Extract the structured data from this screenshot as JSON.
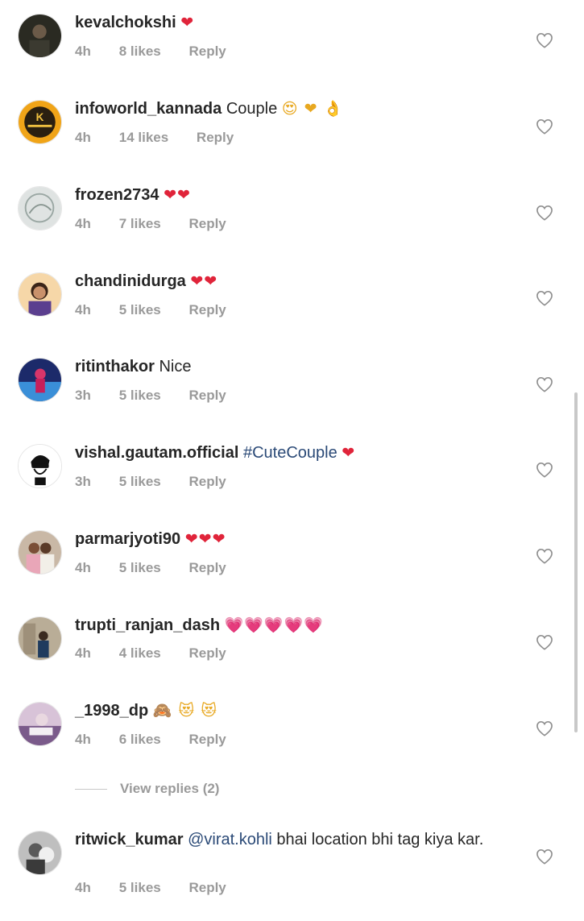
{
  "comments": [
    {
      "username": "kevalchokshi",
      "text": "",
      "emoji": "❤",
      "time": "4h",
      "likes": "8 likes",
      "reply": "Reply"
    },
    {
      "username": "infoworld_kannada",
      "text": "Couple",
      "emoji": "😍 ❤ 👌",
      "time": "4h",
      "likes": "14 likes",
      "reply": "Reply"
    },
    {
      "username": "frozen2734",
      "text": "",
      "emoji": "❤❤",
      "time": "4h",
      "likes": "7 likes",
      "reply": "Reply"
    },
    {
      "username": "chandinidurga",
      "text": "",
      "emoji": "❤❤",
      "time": "4h",
      "likes": "5 likes",
      "reply": "Reply"
    },
    {
      "username": "ritinthakor",
      "text": "Nice",
      "emoji": "",
      "time": "3h",
      "likes": "5 likes",
      "reply": "Reply"
    },
    {
      "username": "vishal.gautam.official",
      "text": "",
      "hashtag": "#CuteCouple",
      "emoji": "❤",
      "time": "3h",
      "likes": "5 likes",
      "reply": "Reply"
    },
    {
      "username": "parmarjyoti90",
      "text": "",
      "emoji": "❤❤❤",
      "time": "4h",
      "likes": "5 likes",
      "reply": "Reply"
    },
    {
      "username": "trupti_ranjan_dash",
      "text": "",
      "emoji": "💗💗💗💗💗",
      "time": "4h",
      "likes": "4 likes",
      "reply": "Reply"
    },
    {
      "username": "_1998_dp",
      "text": "",
      "emoji": "🙈 😻 😻",
      "time": "4h",
      "likes": "6 likes",
      "reply": "Reply"
    },
    {
      "username": "ritwick_kumar",
      "mention": "@virat.kohli",
      "text": "bhai location bhi tag kiya kar.",
      "emoji": "",
      "time": "4h",
      "likes": "5 likes",
      "reply": "Reply"
    }
  ],
  "view_replies": "View replies (2)",
  "icons": {
    "like": "heart-outline-icon"
  },
  "colors": {
    "heart": "#e0243a",
    "pink_heart": "#e04fa8",
    "link": "#2b4a77",
    "meta": "#9a9a9a"
  }
}
